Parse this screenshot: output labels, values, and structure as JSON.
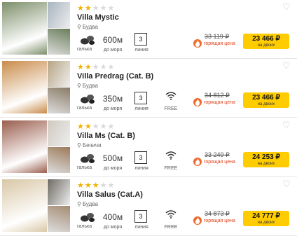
{
  "labels": {
    "pebbles": "галька",
    "to_sea": "до моря",
    "line": "линия",
    "wifi": "FREE",
    "hot": "горящая цена",
    "for_two": "на двоих"
  },
  "hotels": [
    {
      "stars": 2,
      "name": "Villa Mystic",
      "location": "Будва",
      "distance": "600м",
      "line": "3",
      "wifi": false,
      "old_price": "33 119 ₽",
      "price": "23 466 ₽",
      "photo_colors": [
        "#7d8f6a",
        "#a7b4c0",
        "#6a7e5a"
      ]
    },
    {
      "stars": 2,
      "name": "Villa Predrag (Cat. B)",
      "location": "Будва",
      "distance": "350м",
      "line": "3",
      "wifi": true,
      "old_price": "34 812 ₽",
      "price": "23 466 ₽",
      "photo_colors": [
        "#c98b4a",
        "#b7a584",
        "#8a7b66"
      ]
    },
    {
      "stars": 2,
      "name": "Villa Ms (Cat. B)",
      "location": "Бечичи",
      "distance": "500м",
      "line": "3",
      "wifi": true,
      "old_price": "33 249 ₽",
      "price": "24 253 ₽",
      "photo_colors": [
        "#9a5e4e",
        "#cfc9bf",
        "#9c7a5a"
      ]
    },
    {
      "stars": 3,
      "name": "Villa Salus (Cat.A)",
      "location": "Будва",
      "distance": "400м",
      "line": "3",
      "wifi": true,
      "old_price": "34 873 ₽",
      "price": "24 777 ₽",
      "photo_colors": [
        "#d9c7a6",
        "#6e6a63",
        "#a48c73"
      ]
    }
  ],
  "icons": {
    "pin": "map-pin-icon",
    "heart": "heart-outline-icon",
    "pebbles": "pebbles-icon",
    "wifi": "wifi-icon",
    "fire": "fire-icon"
  },
  "colors": {
    "star": "#f2b200",
    "button": "#ffcc00",
    "hot": "#e0431c"
  }
}
